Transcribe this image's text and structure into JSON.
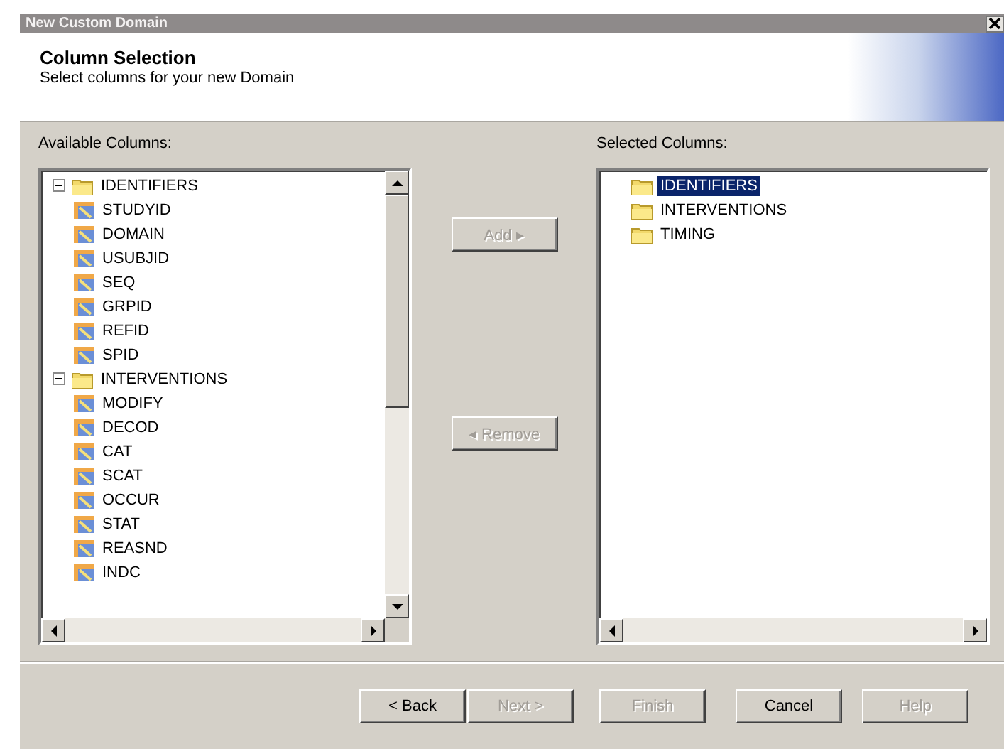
{
  "window": {
    "title": "New Custom Domain"
  },
  "header": {
    "title": "Column Selection",
    "subtitle": "Select columns for your new Domain"
  },
  "available": {
    "label": "Available Columns:",
    "items": [
      {
        "label": "IDENTIFIERS",
        "kind": "folder",
        "expanded": true,
        "selected": false,
        "children": [
          {
            "label": "STUDYID",
            "kind": "column",
            "selected": false
          },
          {
            "label": "DOMAIN",
            "kind": "column",
            "selected": false
          },
          {
            "label": "USUBJID",
            "kind": "column",
            "selected": false
          },
          {
            "label": "SEQ",
            "kind": "column",
            "selected": false
          },
          {
            "label": "GRPID",
            "kind": "column",
            "selected": false
          },
          {
            "label": "REFID",
            "kind": "column",
            "selected": false
          },
          {
            "label": "SPID",
            "kind": "column",
            "selected": false
          }
        ]
      },
      {
        "label": "INTERVENTIONS",
        "kind": "folder",
        "expanded": true,
        "selected": false,
        "children": [
          {
            "label": "MODIFY",
            "kind": "column",
            "selected": false
          },
          {
            "label": "DECOD",
            "kind": "column",
            "selected": false
          },
          {
            "label": "CAT",
            "kind": "column",
            "selected": false
          },
          {
            "label": "SCAT",
            "kind": "column",
            "selected": false
          },
          {
            "label": "OCCUR",
            "kind": "column",
            "selected": false
          },
          {
            "label": "STAT",
            "kind": "column",
            "selected": false
          },
          {
            "label": "REASND",
            "kind": "column",
            "selected": false
          },
          {
            "label": "INDC",
            "kind": "column",
            "selected": false
          }
        ]
      }
    ]
  },
  "actions": [
    {
      "label": "Add ▸",
      "disabled": true
    },
    {
      "label": "◂ Remove",
      "disabled": true
    }
  ],
  "selected_columns": {
    "label": "Selected Columns:",
    "items": [
      {
        "label": "IDENTIFIERS",
        "kind": "folder",
        "selected": true
      },
      {
        "label": "INTERVENTIONS",
        "kind": "folder",
        "selected": false
      },
      {
        "label": "TIMING",
        "kind": "folder",
        "selected": false
      }
    ]
  },
  "buttons": [
    {
      "label": "< Back",
      "disabled": false
    },
    {
      "label": "Next >",
      "disabled": true
    },
    {
      "label": "Finish",
      "disabled": true
    },
    {
      "label": "Cancel",
      "disabled": false
    },
    {
      "label": "Help",
      "disabled": true
    }
  ]
}
